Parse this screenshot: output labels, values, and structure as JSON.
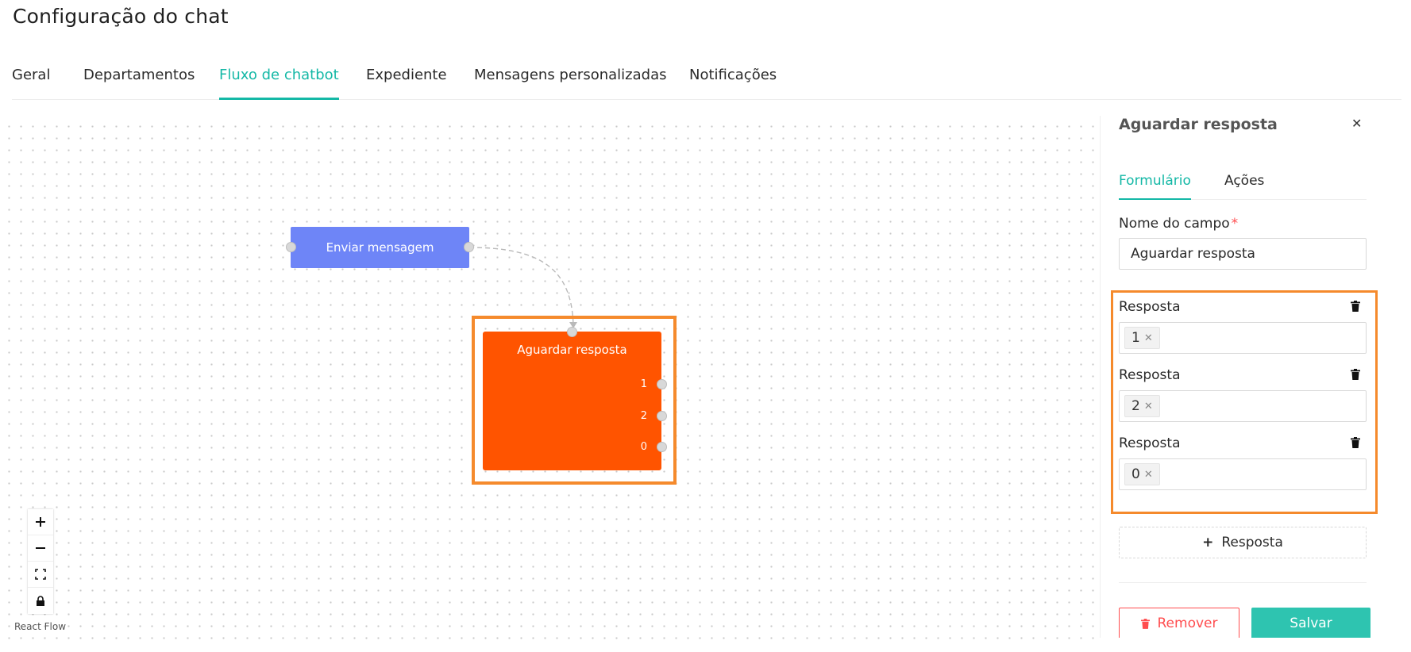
{
  "page": {
    "title": "Configuração do chat"
  },
  "tabs": [
    {
      "label": "Geral"
    },
    {
      "label": "Departamentos"
    },
    {
      "label": "Fluxo de chatbot",
      "active": true
    },
    {
      "label": "Expediente"
    },
    {
      "label": "Mensagens personalizadas"
    },
    {
      "label": "Notificações"
    }
  ],
  "flow": {
    "send_node": {
      "label": "Enviar mensagem",
      "color": "#6e85f7"
    },
    "wait_node": {
      "label": "Aguardar resposta",
      "color": "#ff5400",
      "options": [
        "1",
        "2",
        "0"
      ]
    },
    "attribution": "React Flow",
    "controls": [
      "zoom-in-icon",
      "zoom-out-icon",
      "fit-view-icon",
      "lock-icon"
    ]
  },
  "panel": {
    "title": "Aguardar resposta",
    "tabs": [
      {
        "label": "Formulário",
        "active": true
      },
      {
        "label": "Ações"
      }
    ],
    "field_label": "Nome do campo",
    "field_value": "Aguardar resposta",
    "responses": [
      {
        "label": "Resposta",
        "tag": "1"
      },
      {
        "label": "Resposta",
        "tag": "2"
      },
      {
        "label": "Resposta",
        "tag": "0"
      }
    ],
    "add_response": "Resposta",
    "remove_label": "Remover",
    "save_label": "Salvar"
  },
  "colors": {
    "accent": "#14b8a6",
    "danger": "#ff4d4f",
    "highlight": "#f58a2c"
  }
}
